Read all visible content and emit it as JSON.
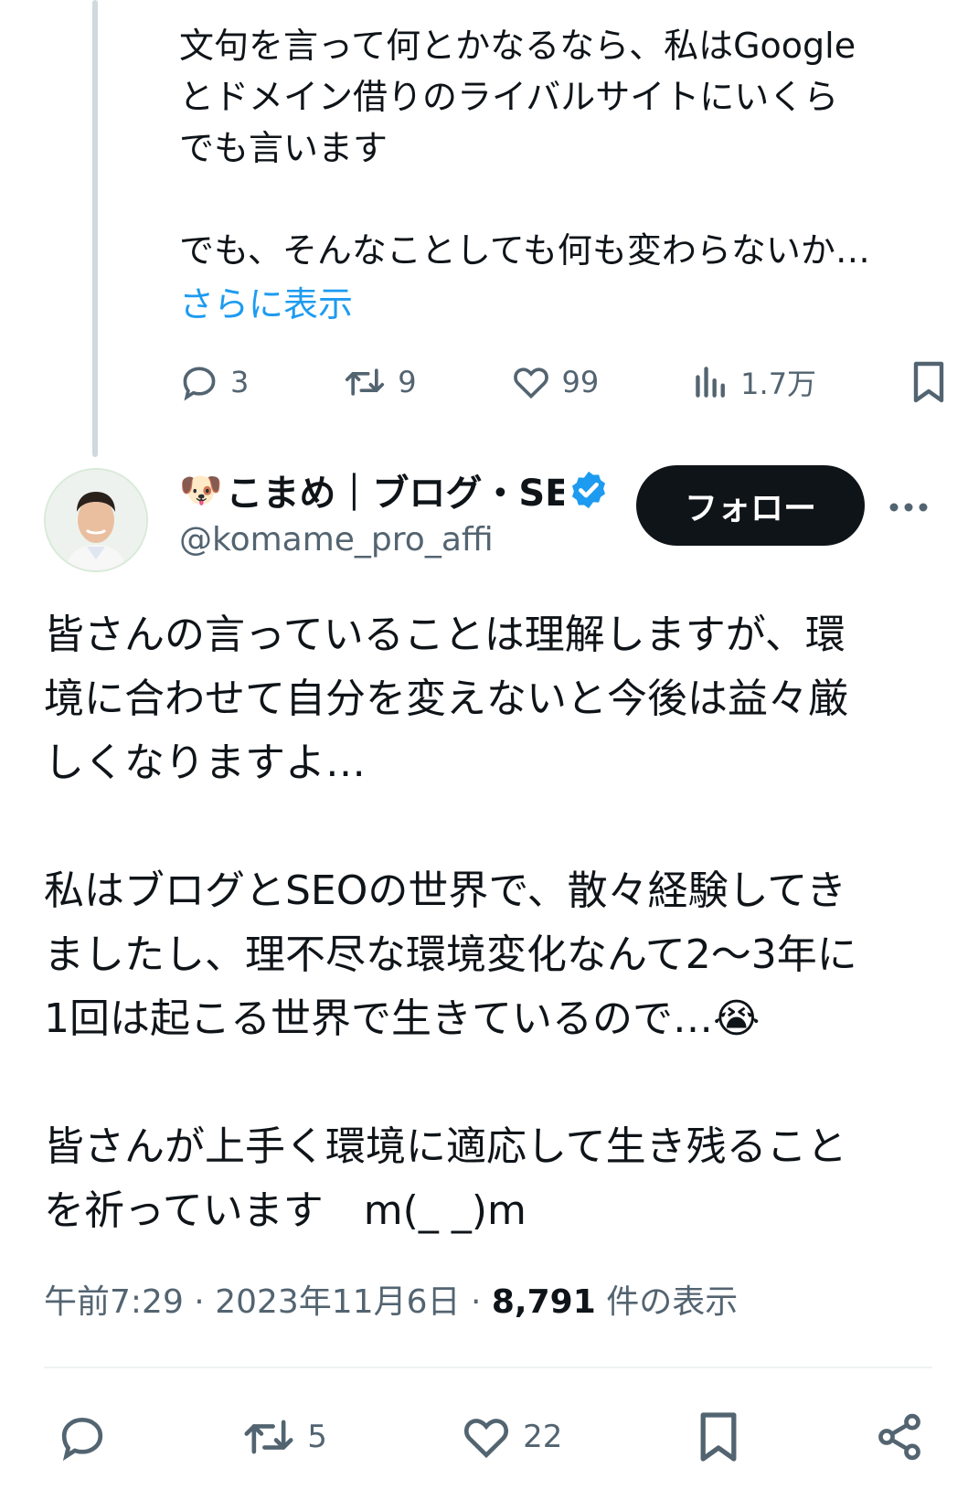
{
  "parent_tweet": {
    "text": "文句を言って何とかなるなら、私はGoogle\nとドメイン借りのライバルサイトにいくら\nでも言います\n\nでも、そんなことしても何も変わらないか…",
    "show_more": "さらに表示",
    "reply_count": "3",
    "retweet_count": "9",
    "like_count": "99",
    "view_count": "1.7万"
  },
  "tweet": {
    "emoji": "🐶",
    "display_name": "こまめ｜ブログ・SEO",
    "handle": "@komame_pro_affi",
    "follow_label": "フォロー",
    "text": "皆さんの言っていることは理解しますが、環\n境に合わせて自分を変えないと今後は益々厳\nしくなりますよ…\n\n私はブログとSEOの世界で、散々経験してき\nましたし、理不尽な環境変化なんて2〜3年に\n1回は起こる世界で生きているので…😭\n\n皆さんが上手く環境に適応して生き残ること\nを祈っています　m(_ _)m",
    "time": "午前7:29",
    "date": "2023年11月6日",
    "views": "8,791",
    "views_label": "件の表示",
    "retweet_count": "5",
    "like_count": "22"
  },
  "colors": {
    "text": "#0f1419",
    "secondary": "#536471",
    "accent": "#1d9bf0",
    "thread_line": "#cfd9de"
  },
  "icons": [
    "reply-icon",
    "retweet-icon",
    "like-icon",
    "views-icon",
    "bookmark-icon",
    "verified-icon",
    "more-icon",
    "share-icon"
  ]
}
